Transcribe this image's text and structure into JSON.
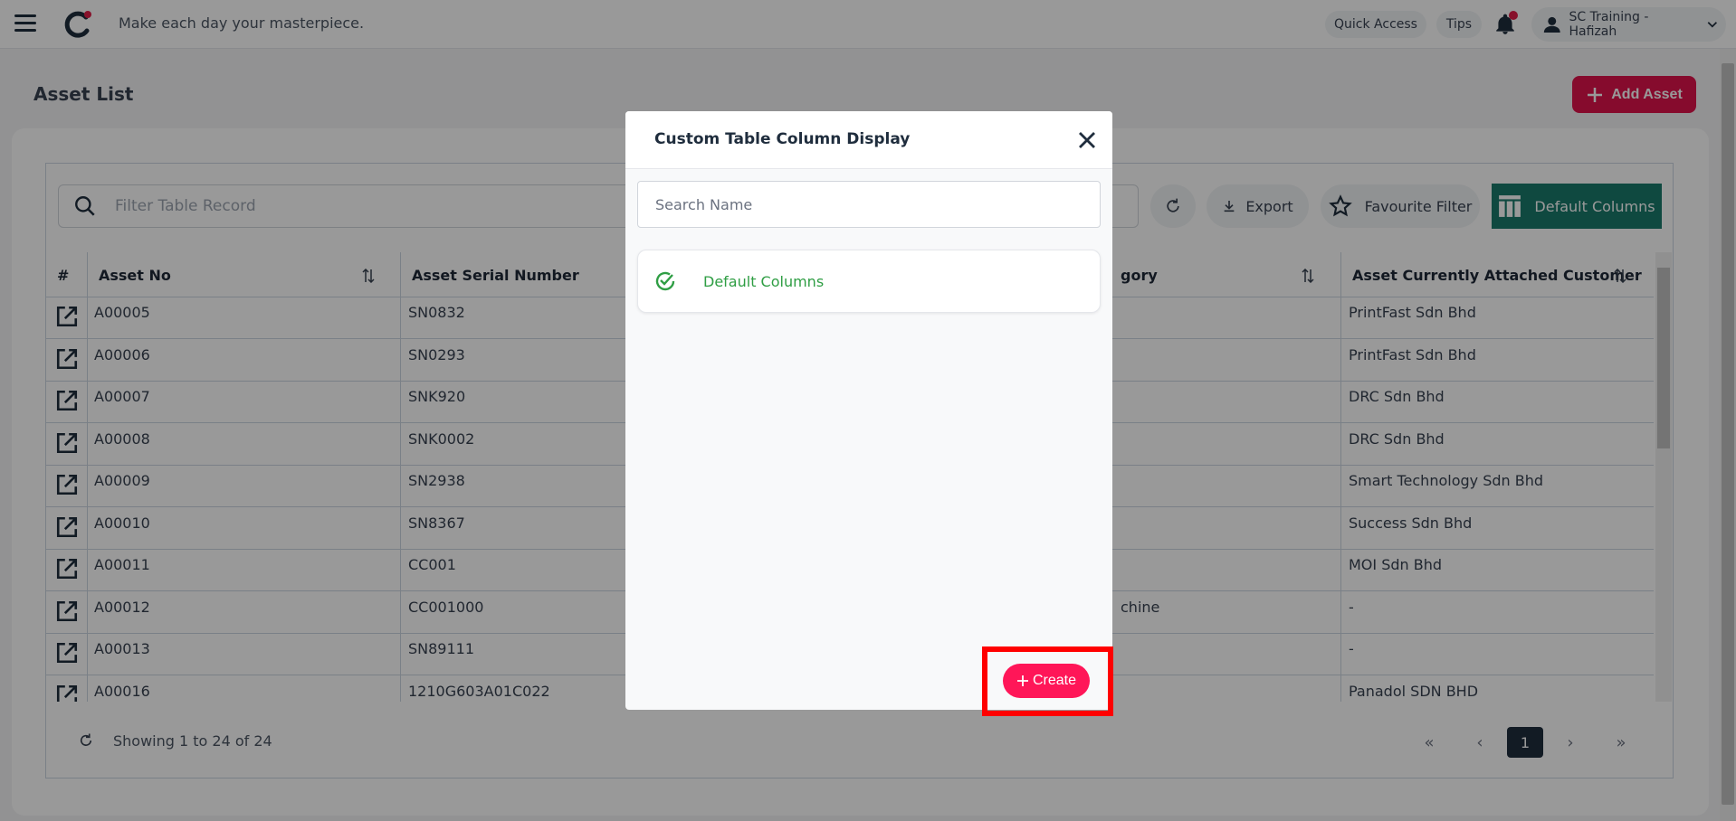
{
  "topbar": {
    "tagline": "Make each day your masterpiece.",
    "quick_access": "Quick Access",
    "tips": "Tips",
    "user": "SC Training - Hafizah"
  },
  "page": {
    "title": "Asset List",
    "add_button": "Add Asset"
  },
  "toolbar": {
    "filter_placeholder": "Filter Table Record",
    "export": "Export",
    "favourite_filter": "Favourite Filter",
    "default_columns": "Default Columns"
  },
  "table": {
    "headers": [
      "#",
      "Asset No",
      "Asset Serial Number",
      "gory",
      "Asset Currently Attached Customer"
    ],
    "rows": [
      {
        "no": "A00005",
        "serial": "SN0832",
        "category": "",
        "customer": "PrintFast Sdn Bhd"
      },
      {
        "no": "A00006",
        "serial": "SN0293",
        "category": "",
        "customer": "PrintFast Sdn Bhd"
      },
      {
        "no": "A00007",
        "serial": "SNK920",
        "category": "",
        "customer": "DRC Sdn Bhd"
      },
      {
        "no": "A00008",
        "serial": "SNK0002",
        "category": "",
        "customer": "DRC Sdn Bhd"
      },
      {
        "no": "A00009",
        "serial": "SN2938",
        "category": "",
        "customer": "Smart Technology Sdn Bhd"
      },
      {
        "no": "A00010",
        "serial": "SN8367",
        "category": "",
        "customer": "Success Sdn Bhd"
      },
      {
        "no": "A00011",
        "serial": "CC001",
        "category": "",
        "customer": "MOI Sdn Bhd"
      },
      {
        "no": "A00012",
        "serial": "CC001000",
        "category": "chine",
        "customer": "-"
      },
      {
        "no": "A00013",
        "serial": "SN89111",
        "category": "",
        "customer": "-"
      },
      {
        "no": "A00016",
        "serial": "1210G603A01C022",
        "category": "",
        "customer": "Panadol SDN BHD"
      }
    ]
  },
  "footer": {
    "showing": "Showing 1 to 24 of 24",
    "pagination": {
      "first": "«",
      "prev": "‹",
      "current": "1",
      "next": "›",
      "last": "»"
    }
  },
  "modal": {
    "title": "Custom Table Column Display",
    "search_placeholder": "Search Name",
    "items": [
      {
        "label": "Default Columns",
        "selected": true
      }
    ],
    "create_label": "Create"
  },
  "colors": {
    "brand": "#e0134b",
    "create": "#ff1658",
    "teal": "#1a7a6c",
    "selected_green": "#2f9e44",
    "highlight": "#ff0000"
  }
}
